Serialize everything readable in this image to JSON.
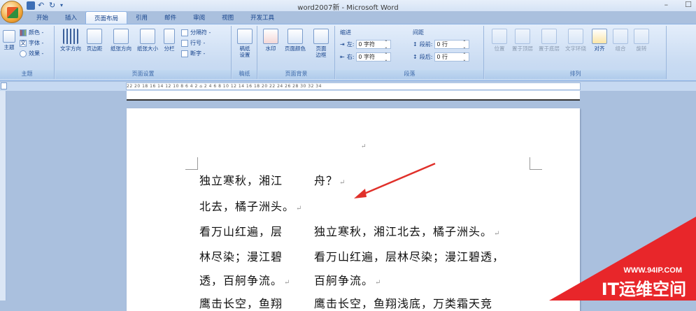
{
  "window": {
    "title": "word2007新 - Microsoft Word",
    "minimize": "–",
    "restore": "☐"
  },
  "tabs": [
    "开始",
    "插入",
    "页面布局",
    "引用",
    "邮件",
    "审阅",
    "视图",
    "开发工具"
  ],
  "active_tab": "页面布局",
  "ribbon": {
    "theme": {
      "title": "主题",
      "theme_btn": "主题",
      "colors": "颜色 -",
      "fonts": "字体 -",
      "effects": "效果 -"
    },
    "page_setup": {
      "title": "页面设置",
      "text_dir": "文字方向",
      "margins": "页边距",
      "orientation": "纸张方向",
      "size": "纸张大小",
      "columns": "分栏",
      "breaks": "分隔符 -",
      "line_numbers": "行号 -",
      "hyphenation": "断字 -"
    },
    "draft": {
      "title": "稿纸",
      "btn": "稿纸\n设置"
    },
    "page_bg": {
      "title": "页面背景",
      "watermark": "水印",
      "page_color": "页面颜色",
      "borders": "页面\n边框"
    },
    "paragraph": {
      "title": "段落",
      "indent": "缩进",
      "spacing": "间距",
      "left_label": "左:",
      "left_val": "0 字符",
      "right_label": "右:",
      "right_val": "0 字符",
      "before_label": "段前:",
      "before_val": "0 行",
      "after_label": "段后:",
      "after_val": "0 行"
    },
    "arrange": {
      "title": "排列",
      "position": "位置",
      "front": "置于顶层",
      "back": "置于底层",
      "wrap": "文字环绕",
      "align": "对齐",
      "group": "组合",
      "rotate": "旋转"
    }
  },
  "ruler_text": "22  20  18  16  14  12  10  8  6  4  2  ⌂  2  4  6  8  10  12  14  16  18  20  22  24  26  28  30  32  34",
  "document": {
    "lines": [
      {
        "left": "独立寒秋，湘江",
        "right": "舟？",
        "mark": "↵"
      },
      {
        "left": "北去，橘子洲头。",
        "right": "",
        "mark": "↵"
      },
      {
        "left": "看万山红遍，层",
        "right": "独立寒秋，湘江北去，橘子洲头。",
        "mark": "↵"
      },
      {
        "left": "林尽染；漫江碧",
        "right": "看万山红遍，层林尽染；漫江碧透，",
        "mark": ""
      },
      {
        "left": "透，百舸争流。",
        "right": "百舸争流。",
        "mark": "↵"
      },
      {
        "left": "鹰击长空，鱼翔",
        "right": "鹰击长空，鱼翔浅底，万类霜天竞",
        "mark": ""
      }
    ],
    "top_mark": "↵"
  },
  "watermark": {
    "url": "WWW.94IP.COM",
    "brand": "IT运维空间",
    "color": "#e8262a"
  }
}
